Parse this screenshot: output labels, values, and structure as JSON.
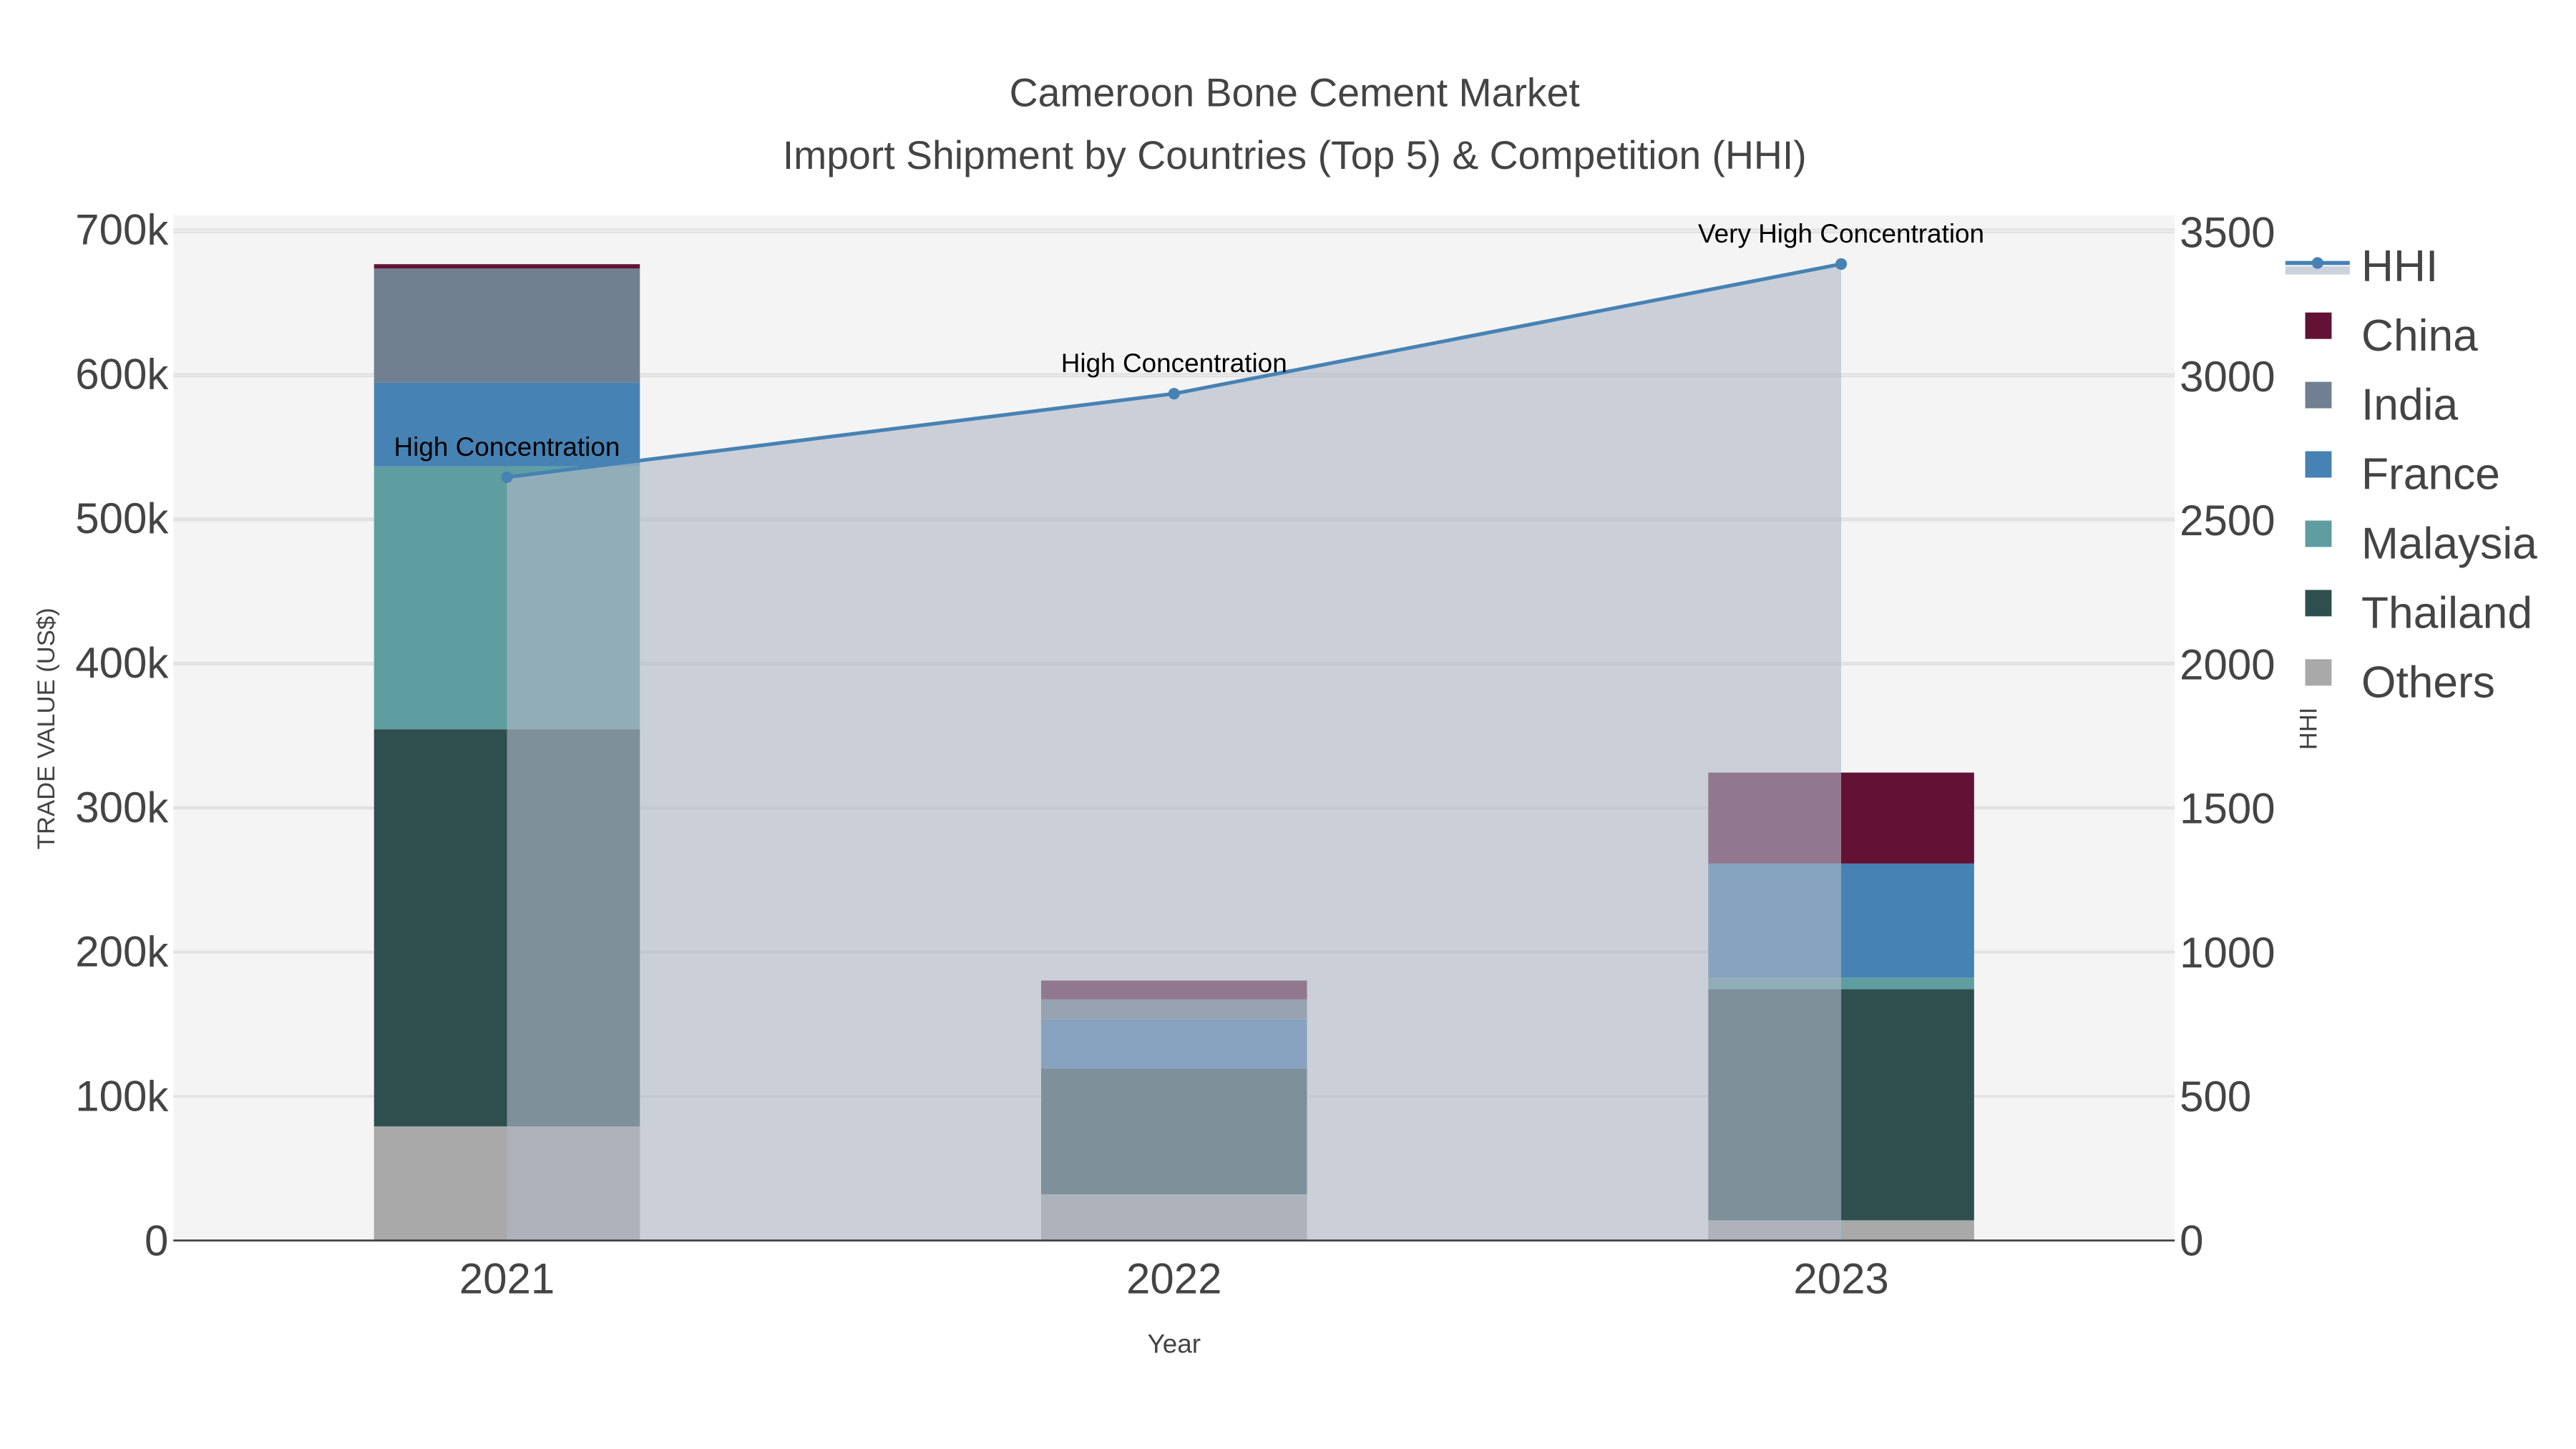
{
  "chart_data": {
    "type": "bar",
    "title": "Cameroon Bone Cement Market",
    "subtitle": "Import Shipment by Countries (Top 5) & Competition (HHI)",
    "xlabel": "Year",
    "ylabel": "TRADE VALUE (US$)",
    "y2label": "HHI",
    "categories": [
      "2021",
      "2022",
      "2023"
    ],
    "ylim": [
      0,
      710000
    ],
    "y2lim": [
      0,
      3560
    ],
    "yticks": [
      0,
      100000,
      200000,
      300000,
      400000,
      500000,
      600000,
      700000
    ],
    "ytick_labels": [
      "0",
      "100k",
      "200k",
      "300k",
      "400k",
      "500k",
      "600k",
      "700k"
    ],
    "y2ticks": [
      0,
      500,
      1000,
      1500,
      2000,
      2500,
      3000,
      3500
    ],
    "y2tick_labels": [
      "0",
      "500",
      "1000",
      "1500",
      "2000",
      "2500",
      "3000",
      "3500"
    ],
    "grid": true,
    "legend_position": "right",
    "series": [
      {
        "name": "Others",
        "color": "#a9a9a9",
        "values": [
          79000,
          32000,
          14000
        ]
      },
      {
        "name": "Thailand",
        "color": "#2f4f4f",
        "values": [
          275000,
          87000,
          160000
        ]
      },
      {
        "name": "Malaysia",
        "color": "#5f9ea0",
        "values": [
          182000,
          0,
          8000
        ]
      },
      {
        "name": "France",
        "color": "#4682b4",
        "values": [
          58000,
          34000,
          79000
        ]
      },
      {
        "name": "India",
        "color": "#708090",
        "values": [
          79000,
          14000,
          0
        ]
      },
      {
        "name": "China",
        "color": "#621234",
        "values": [
          3000,
          13000,
          63000
        ]
      }
    ],
    "hhi": {
      "name": "HHI",
      "color": "#4682b4",
      "values": [
        2650,
        2940,
        3390
      ],
      "annotations": [
        "High Concentration",
        "High Concentration",
        "Very High Concentration"
      ]
    },
    "legend_order": [
      "HHI",
      "China",
      "India",
      "France",
      "Malaysia",
      "Thailand",
      "Others"
    ]
  }
}
